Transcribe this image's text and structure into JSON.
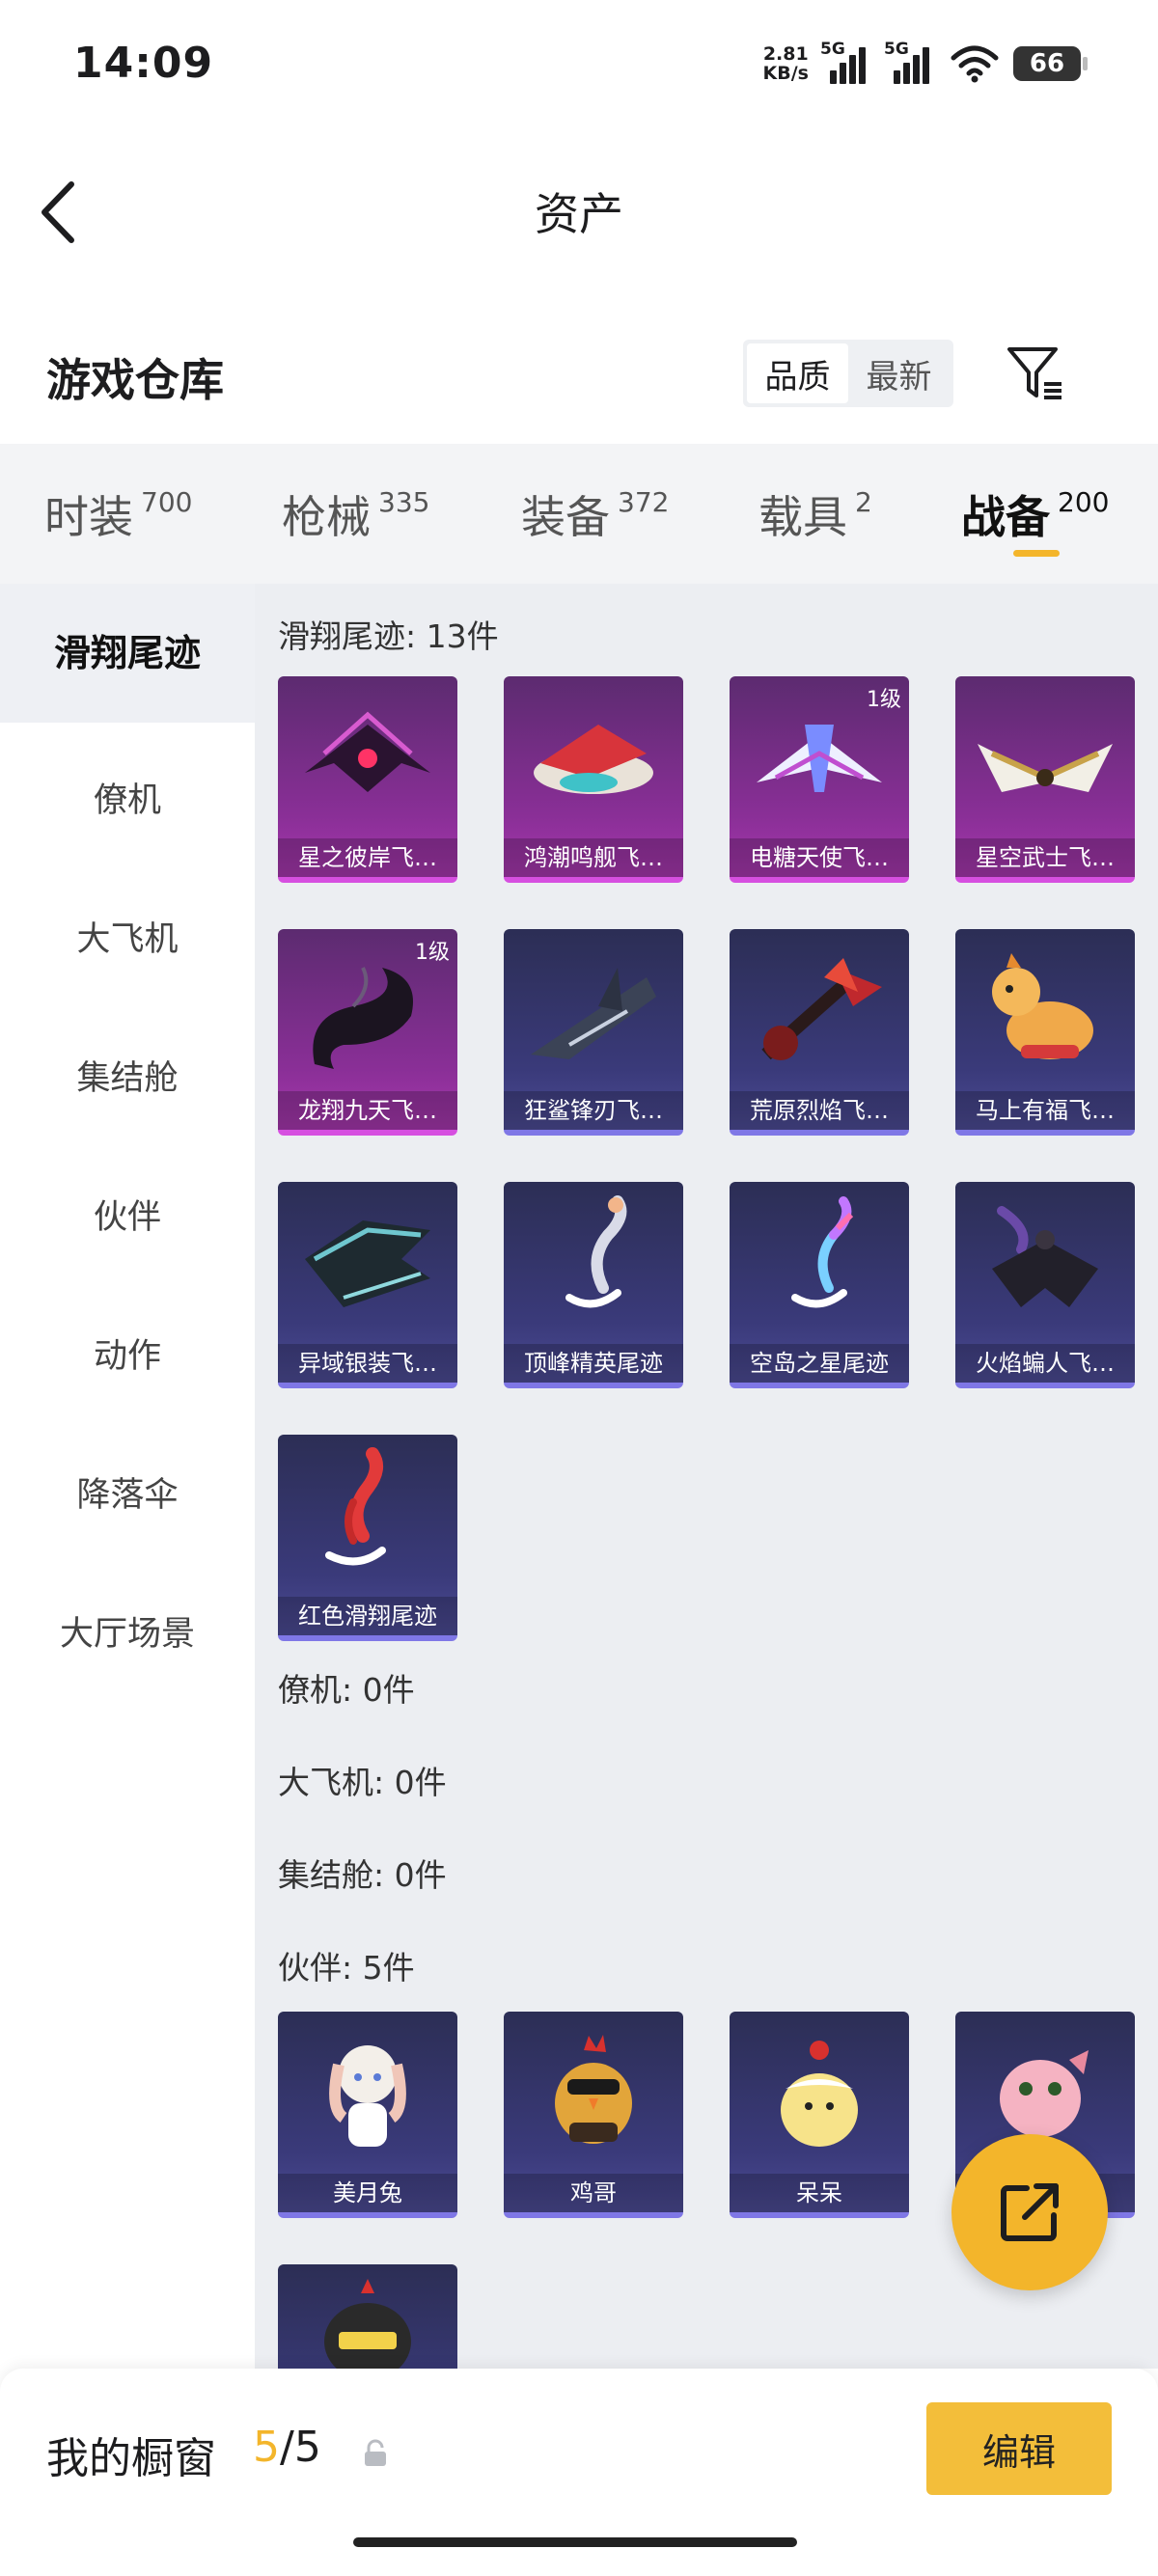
{
  "status_bar": {
    "time": "14:09",
    "net_speed_value": "2.81",
    "net_speed_unit": "KB/s",
    "signal_1_label": "5G",
    "signal_2_label": "5G",
    "battery": "66"
  },
  "header": {
    "title": "资产"
  },
  "warehouse": {
    "title": "游戏仓库",
    "sort_options": [
      "品质",
      "最新"
    ],
    "active_sort": "品质"
  },
  "tabs": [
    {
      "label": "时装",
      "count": "700"
    },
    {
      "label": "枪械",
      "count": "335"
    },
    {
      "label": "装备",
      "count": "372"
    },
    {
      "label": "载具",
      "count": "2"
    },
    {
      "label": "战备",
      "count": "200",
      "active": true
    }
  ],
  "sidebar": {
    "items": [
      "滑翔尾迹",
      "僚机",
      "大飞机",
      "集结舱",
      "伙伴",
      "动作",
      "降落伞",
      "大厅场景"
    ],
    "active": "滑翔尾迹"
  },
  "sections": {
    "glide_trail": {
      "title": "滑翔尾迹: 13件",
      "items": [
        {
          "name": "星之彼岸飞…",
          "quality": "purple",
          "icon": "purple-spiked-glider-icon"
        },
        {
          "name": "鸿潮鸣舰飞…",
          "quality": "purple",
          "icon": "red-white-ship-glider-icon"
        },
        {
          "name": "电糖天使飞…",
          "quality": "purple",
          "level": "1级",
          "icon": "white-blue-jet-glider-icon"
        },
        {
          "name": "星空武士飞…",
          "quality": "purple",
          "icon": "gold-white-wing-glider-icon"
        },
        {
          "name": "龙翔九天飞…",
          "quality": "purple",
          "level": "1级",
          "icon": "black-dragon-glider-icon"
        },
        {
          "name": "狂鲨锋刃飞…",
          "quality": "blue",
          "icon": "shark-glider-icon"
        },
        {
          "name": "荒原烈焰飞…",
          "quality": "blue",
          "icon": "red-guitar-glider-icon"
        },
        {
          "name": "马上有福飞…",
          "quality": "blue",
          "icon": "toy-horse-glider-icon"
        },
        {
          "name": "异域银装飞…",
          "quality": "blue",
          "icon": "silver-wing-glider-icon"
        },
        {
          "name": "顶峰精英尾迹",
          "quality": "blue",
          "icon": "smoke-trail-icon"
        },
        {
          "name": "空岛之星尾迹",
          "quality": "blue",
          "icon": "rainbow-smoke-trail-icon"
        },
        {
          "name": "火焰蝙人飞…",
          "quality": "blue",
          "icon": "bat-wingsuit-glider-icon"
        },
        {
          "name": "红色滑翔尾迹",
          "quality": "blue",
          "icon": "red-smoke-trail-icon"
        }
      ]
    },
    "wingman": {
      "title": "僚机: 0件"
    },
    "big_plane": {
      "title": "大飞机: 0件"
    },
    "assembly_pod": {
      "title": "集结舱: 0件"
    },
    "partner": {
      "title": "伙伴: 5件",
      "items": [
        {
          "name": "美月兔",
          "quality": "blue",
          "icon": "white-rabbit-icon"
        },
        {
          "name": "鸡哥",
          "quality": "blue",
          "icon": "rooster-sunglasses-icon"
        },
        {
          "name": "呆呆",
          "quality": "blue",
          "icon": "yellow-chick-icon"
        },
        {
          "name": "",
          "quality": "blue",
          "icon": "pink-bird-icon"
        },
        {
          "name": "",
          "quality": "blue",
          "icon": "helmet-character-icon"
        }
      ]
    }
  },
  "bottom_bar": {
    "label": "我的橱窗",
    "current": "5",
    "total": "/5",
    "edit_label": "编辑"
  },
  "colors": {
    "accent": "#f3b52b",
    "purple_quality": "#a637ad",
    "blue_quality": "#4c4b94"
  }
}
